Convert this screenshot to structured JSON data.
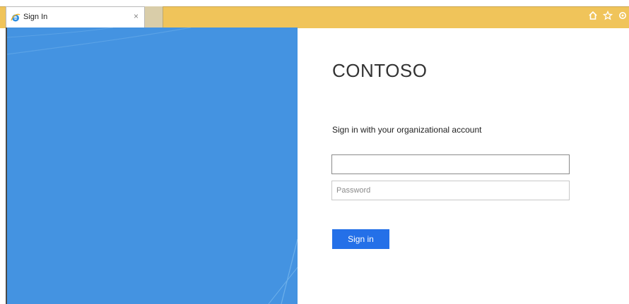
{
  "browser": {
    "tab_title": "Sign In",
    "tab_close": "×",
    "colors": {
      "tabstrip": "#f0c45a",
      "newtab": "#d9cda9"
    },
    "toolbar_icons": [
      "home-icon",
      "favorites-star-icon",
      "settings-gear-icon"
    ]
  },
  "page": {
    "brand": "CONTOSO",
    "subtitle": "Sign in with your organizational account",
    "username": {
      "value": "",
      "placeholder": ""
    },
    "password": {
      "value": "",
      "placeholder": "Password"
    },
    "signin_label": "Sign in",
    "colors": {
      "panel": "#4493e1",
      "button": "#2470e8"
    }
  }
}
